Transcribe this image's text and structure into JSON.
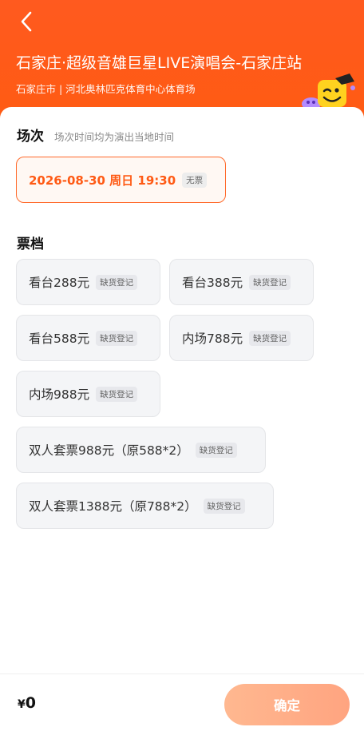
{
  "header": {
    "title": "石家庄·超级音雄巨星LIVE演唱会-石家庄站",
    "venue": "石家庄市 | 河北奥林匹克体育中心体育场",
    "brand_color": "#ff5a1f"
  },
  "sessions": {
    "title": "场次",
    "note": "场次时间均为演出当地时间",
    "items": [
      {
        "label": "2026-08-30  周日 19:30",
        "badge": "无票"
      }
    ]
  },
  "tickets": {
    "title": "票档",
    "items": [
      {
        "label": "看台288元",
        "badge": "缺货登记"
      },
      {
        "label": "看台388元",
        "badge": "缺货登记"
      },
      {
        "label": "看台588元",
        "badge": "缺货登记"
      },
      {
        "label": "内场788元",
        "badge": "缺货登记"
      },
      {
        "label": "内场988元",
        "badge": "缺货登记"
      },
      {
        "label": "双人套票988元（原588*2）",
        "badge": "缺货登记"
      },
      {
        "label": "双人套票1388元（原788*2）",
        "badge": "缺货登记"
      }
    ]
  },
  "footer": {
    "currency": "¥",
    "total": "0",
    "confirm_label": "确定"
  }
}
